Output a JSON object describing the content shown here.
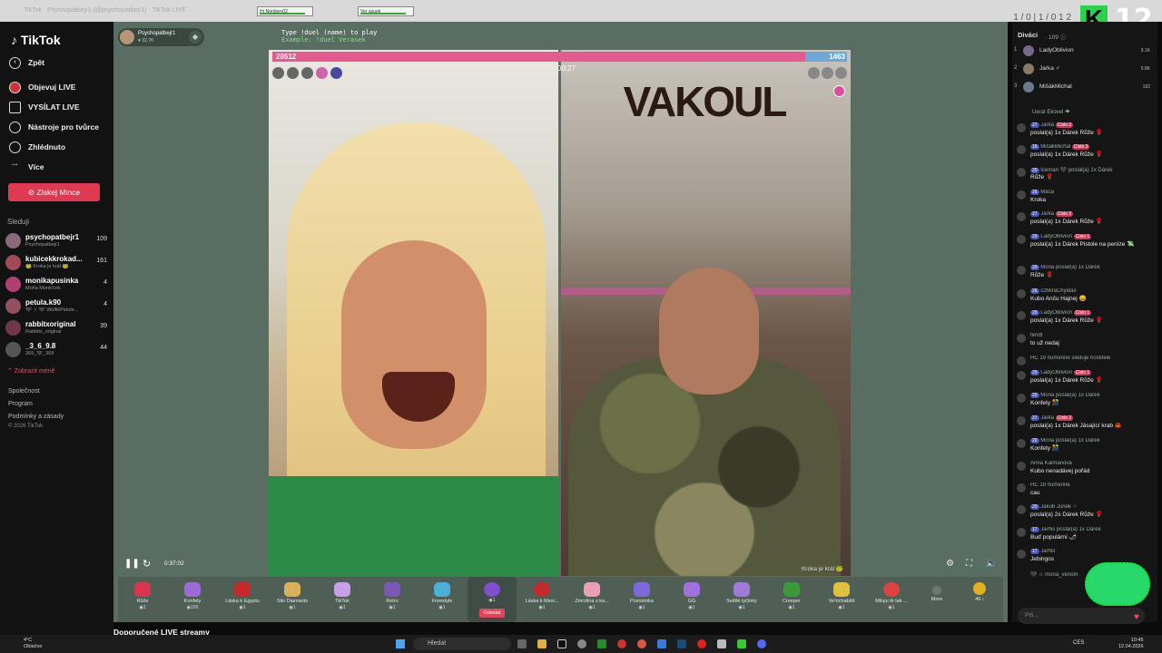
{
  "browser": {
    "tab1": "Hr Nordsey02",
    "tab2": "Ver asuek",
    "url": "TikTok · Psychopatbejr1 (@psychopatbejr1) · TikTok LIVE",
    "counter": "1 / 0 | 1 / 0 1 2"
  },
  "overlay": {
    "k": "K",
    "num": "12"
  },
  "sidebar": {
    "logo": "TikTok",
    "nav": [
      {
        "label": "Zpět",
        "icon": "back-icon"
      },
      {
        "label": "Objevuj LIVE",
        "icon": "live-icon"
      },
      {
        "label": "VYSÍLAT LIVE",
        "icon": "camera-icon"
      },
      {
        "label": "Nástroje pro tvůrce",
        "icon": "bulb-icon"
      },
      {
        "label": "Zhlédnuto",
        "icon": "history-icon"
      },
      {
        "label": "Více",
        "icon": "more-icon"
      }
    ],
    "coins": "Získej Mince",
    "following_title": "Sleduji",
    "following": [
      {
        "name": "psychopatbejr1",
        "sub": "Psychopatbejr1",
        "count": "109"
      },
      {
        "name": "kubicekkrokad...",
        "sub": "🐸 Kroka je král 🐸",
        "count": "161"
      },
      {
        "name": "monikapusinka",
        "sub": "Moňa Moničček",
        "count": "4"
      },
      {
        "name": "petula.k90",
        "sub": "🖤 ☆ 🖤 WolfikPetule...",
        "count": "4"
      },
      {
        "name": "rabbitxoriginal",
        "sub": "Rabbitx_original",
        "count": "39"
      },
      {
        "name": "_3_6_9.8",
        "sub": "369_🖤_369",
        "count": "44"
      }
    ],
    "show_less": "⌃ Zobrazit méně",
    "footer": [
      "Společnost",
      "Program",
      "Podmínky a zásady",
      "© 2026 TikTok"
    ]
  },
  "stream": {
    "host_name": "Psychopatbejr1",
    "host_likes": "♥ 32.7K",
    "command_line1": "Type !duel (name) to play",
    "command_line2": "Example: !duel Verasek",
    "score_left": "20512",
    "score_right": "1463",
    "timer": "00:27",
    "caption_right": "Kroka je král 🐸",
    "banner": "VAKOUL",
    "elapsed": "0:37:02"
  },
  "gifts": [
    {
      "label": "Růže",
      "price": "◉1",
      "color": "#d8364f"
    },
    {
      "label": "Konfety",
      "price": "◉100",
      "color": "#9b6bd6"
    },
    {
      "label": "Láska k Egyptu",
      "price": "◉1",
      "color": "#c42a2a"
    },
    {
      "label": "Silo Diamants",
      "price": "◉1",
      "color": "#d9b15b"
    },
    {
      "label": "TikTok",
      "price": "◉1",
      "color": "#c8a0e8"
    },
    {
      "label": "Retro",
      "price": "◉1",
      "color": "#7b58b6"
    },
    {
      "label": "Freestyle",
      "price": "◉1",
      "color": "#4ab0d8"
    },
    {
      "label": "Odeslat",
      "price": "◉1",
      "color": "#7e4fd0"
    },
    {
      "label": "Láska k Mexi...",
      "price": "◉1",
      "color": "#c42a2a"
    },
    {
      "label": "Zmrzlina s ka...",
      "price": "◉1",
      "color": "#e8a0b8"
    },
    {
      "label": "Poznámka",
      "price": "◉1",
      "color": "#7c6ad8"
    },
    {
      "label": "GG",
      "price": "◉1",
      "color": "#a070e0"
    },
    {
      "label": "Světlé tyčinky",
      "price": "◉1",
      "color": "#a07ad6"
    },
    {
      "label": "Creeper",
      "price": "◉1",
      "color": "#3a9a3a"
    },
    {
      "label": "Ve!ochabitit",
      "price": "◉1",
      "color": "#e0c040"
    },
    {
      "label": "Miluju tě tak ...",
      "price": "◉1",
      "color": "#e04040"
    },
    {
      "label": "More",
      "price": "",
      "color": "#6a7a70"
    },
    {
      "label": "46 ›",
      "price": "",
      "color": "#e0b020"
    }
  ],
  "send_label": "Odeslat",
  "recommended": "Doporučené LIVE streamy",
  "chat": {
    "viewers_label": "Diváci",
    "viewers_count": "· 109 ⓘ",
    "ranks": [
      {
        "n": "1",
        "name": "LadyOblivion",
        "score": "9.1K"
      },
      {
        "n": "2",
        "name": "Jarka ♂",
        "score": "5.8K"
      },
      {
        "n": "3",
        "name": "MišákMichal",
        "score": "192"
      }
    ],
    "messages": [
      {
        "head": "Ueral·Ekovel·❤",
        "lvl": "",
        "badge": "",
        "body": ""
      },
      {
        "head": "Jarka",
        "lvl": "27",
        "badge": "Číslo 2",
        "body": "poslal(a) 1x Dárek Růže 🌹"
      },
      {
        "head": "MišákMichal",
        "lvl": "16",
        "badge": "Číslo 3",
        "body": "poslal(a) 1x Dárek Růže 🌹"
      },
      {
        "head": "Iceman 🖤 poslal(a) 1x Dárek",
        "lvl": "20",
        "badge": "",
        "body": "Růže 🌹"
      },
      {
        "head": "Máca",
        "lvl": "26",
        "badge": "",
        "body": "Kroka"
      },
      {
        "head": "Jarka",
        "lvl": "27",
        "badge": "Číslo 2",
        "body": "poslal(a) 1x Dárek Růže 🌹"
      },
      {
        "head": "LadyOblivion",
        "lvl": "29",
        "badge": "Číslo 1",
        "body": "poslal(a) 1x Dárek Pistole na peníze 💸"
      },
      {
        "head": "Mona poslal(a) 1x Dárek",
        "lvl": "20",
        "badge": "",
        "body": "Růže 🌹"
      },
      {
        "head": "czMiraChyidax",
        "lvl": "26",
        "badge": "",
        "body": "Kubo Anču Hajnej 😅"
      },
      {
        "head": "LadyOblivion",
        "lvl": "29",
        "badge": "Číslo 1",
        "body": "poslal(a) 1x Dárek Růže 🌹"
      },
      {
        "head": "fendt",
        "lvl": "",
        "badge": "",
        "body": "to už nedaj"
      },
      {
        "head": "LadyOblivion",
        "lvl": "29",
        "badge": "Číslo 1",
        "body": "poslal(a) 1x Dárek Růže 🌹"
      },
      {
        "head": "HC 19 humenne  sleduje hostitele",
        "lvl": "",
        "badge": "",
        "body": ""
      },
      {
        "head": "LadyOblivion",
        "lvl": "29",
        "badge": "Číslo 1",
        "body": "poslal(a) 1x Dárek Růže 🌹"
      },
      {
        "head": "Mona poslal(a) 1x Dárek",
        "lvl": "20",
        "badge": "",
        "body": "Konfety 🎊"
      },
      {
        "head": "Jarka",
        "lvl": "27",
        "badge": "Číslo 2",
        "body": "poslal(a) 1x Dárek Jásající krab 🦀"
      },
      {
        "head": "Mona poslal(a) 1x Dárek",
        "lvl": "20",
        "badge": "",
        "body": "Konfety 🎊"
      },
      {
        "head": "Anna Kalmanová",
        "lvl": "",
        "badge": "",
        "body": "Kubo nenadávej pořád"
      },
      {
        "head": "HC 19 humenne",
        "lvl": "",
        "badge": "",
        "body": "cau"
      },
      {
        "head": "Jakub Junek ♂",
        "lvl": "20",
        "badge": "",
        "body": "poslal(a) 2x Dárek Růže 🌹"
      },
      {
        "head": "Jarhis poslal(a) 1x Dárek",
        "lvl": "17",
        "badge": "",
        "body": "Buď populární 🌶"
      },
      {
        "head": "Jarhis",
        "lvl": "17",
        "badge": "",
        "body": "Jebingos"
      },
      {
        "head": "🖤 ☆ mona_venom",
        "lvl": "",
        "badge": "",
        "body": ""
      }
    ],
    "input_placeholder": "Píš..."
  },
  "taskbar": {
    "weather_temp": "4°C",
    "weather_desc": "Oblačno",
    "search": "Hledat",
    "lang": "CES",
    "time": "10:45",
    "date": "12.04.2026"
  }
}
